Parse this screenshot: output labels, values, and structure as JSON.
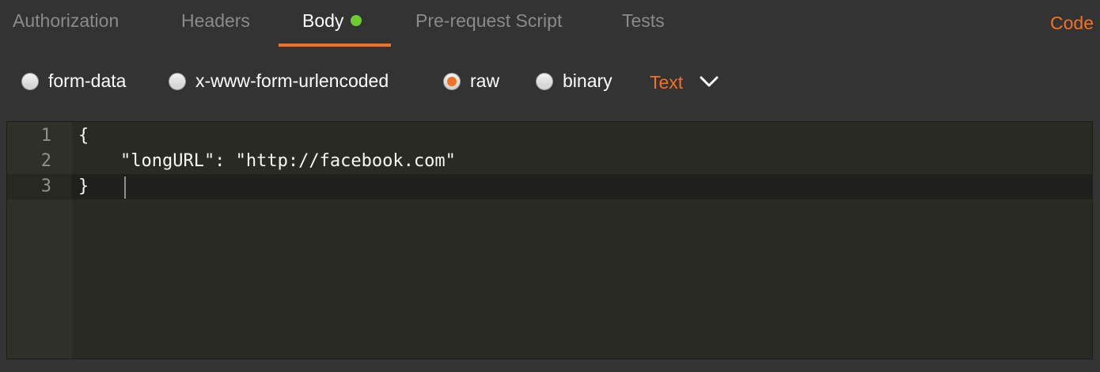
{
  "tabs": [
    {
      "label": "Authorization"
    },
    {
      "label": "Headers"
    },
    {
      "label": "Body"
    },
    {
      "label": "Pre-request Script"
    },
    {
      "label": "Tests"
    }
  ],
  "active_tab": "Body",
  "active_indicator_color": "#6ccd33",
  "accent_color": "#f47023",
  "code_link": "Code",
  "body_types": [
    {
      "label": "form-data",
      "checked": false
    },
    {
      "label": "x-www-form-urlencoded",
      "checked": false
    },
    {
      "label": "raw",
      "checked": true
    },
    {
      "label": "binary",
      "checked": false
    }
  ],
  "raw_type": {
    "value": "Text",
    "icon": "chevron-down-icon"
  },
  "editor": {
    "lines": [
      {
        "number": "1",
        "text": "{"
      },
      {
        "number": "2",
        "text": "    \"longURL\": \"http://facebook.com\""
      },
      {
        "number": "3",
        "text": "}"
      }
    ],
    "active_line": "3"
  }
}
